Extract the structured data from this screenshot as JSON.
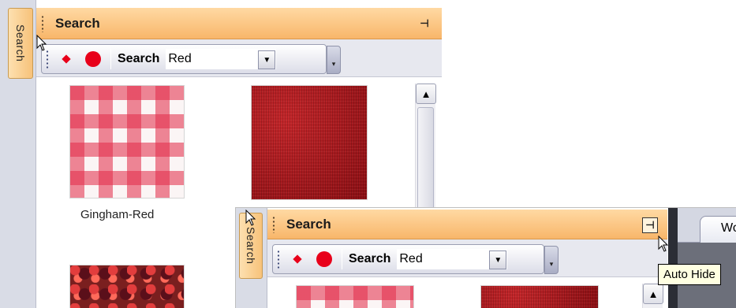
{
  "panel": {
    "side_tab_label": "Search",
    "title": "Search",
    "pin_icon": "pin-icon"
  },
  "toolbar": {
    "search_label": "Search",
    "combo_value": "Red",
    "combo_arrow": "▼",
    "overflow": "▾"
  },
  "items": [
    {
      "name": "Gingham-Red",
      "texture": "gingham"
    },
    {
      "name": "",
      "texture": "denim"
    },
    {
      "name": "",
      "texture": "berries"
    }
  ],
  "second": {
    "side_tab_label": "Search",
    "title": "Search",
    "search_label": "Search",
    "combo_value": "Red",
    "doc_tab_label": "Wo",
    "tooltip": "Auto Hide"
  },
  "colors": {
    "title_bar": "#f8b66a",
    "accent_red": "#e8001a",
    "tooltip_bg": "#ffffe1"
  }
}
